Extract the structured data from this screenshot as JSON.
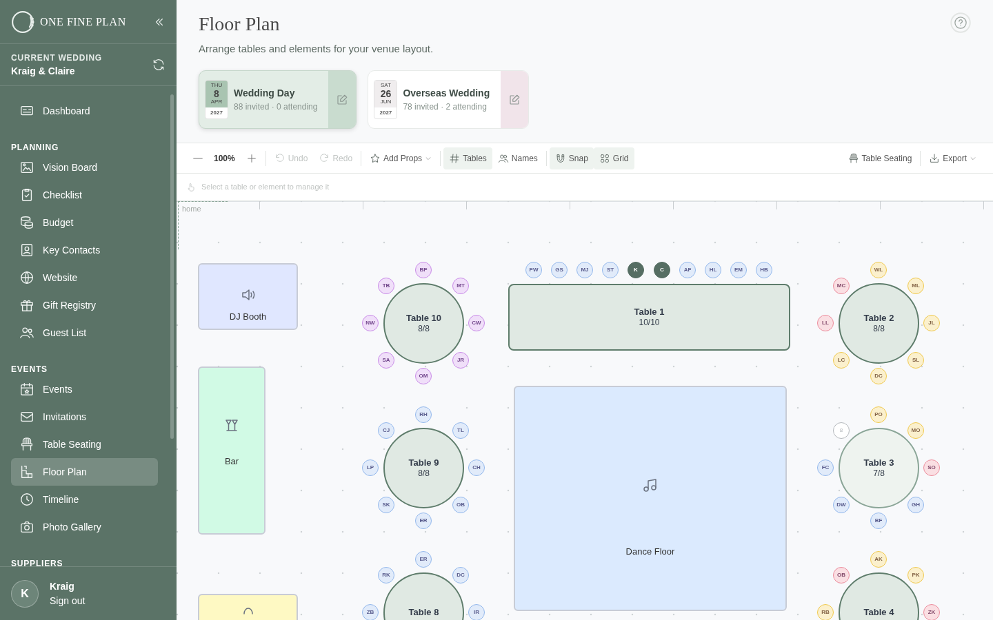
{
  "sidebar": {
    "brand": "ONE FINE PLAN",
    "current_wedding": {
      "label": "CURRENT WEDDING",
      "name": "Kraig & Claire"
    },
    "sections": [
      {
        "items": [
          {
            "label": "Dashboard",
            "selected": false
          }
        ]
      },
      {
        "heading": "PLANNING",
        "items": [
          {
            "label": "Vision Board",
            "selected": false
          },
          {
            "label": "Checklist",
            "selected": false
          },
          {
            "label": "Budget",
            "selected": false
          },
          {
            "label": "Key Contacts",
            "selected": false
          },
          {
            "label": "Website",
            "selected": false
          },
          {
            "label": "Gift Registry",
            "selected": false
          },
          {
            "label": "Guest List",
            "selected": false
          }
        ]
      },
      {
        "heading": "EVENTS",
        "items": [
          {
            "label": "Events",
            "selected": false
          },
          {
            "label": "Invitations",
            "selected": false
          },
          {
            "label": "Table Seating",
            "selected": false
          },
          {
            "label": "Floor Plan",
            "selected": true
          },
          {
            "label": "Timeline",
            "selected": false
          },
          {
            "label": "Photo Gallery",
            "selected": false
          }
        ]
      },
      {
        "heading": "SUPPLIERS"
      }
    ],
    "user": {
      "initial": "K",
      "name": "Kraig",
      "action": "Sign out"
    }
  },
  "header": {
    "title": "Floor Plan",
    "subtitle": "Arrange tables and elements for your venue layout."
  },
  "events": [
    {
      "weekday": "THU",
      "day": "8",
      "month": "APR",
      "year": "2027",
      "name": "Wedding Day",
      "stats": "88 invited · 0 attending",
      "selected": true,
      "color": "#c9dccf"
    },
    {
      "weekday": "SAT",
      "day": "26",
      "month": "JUN",
      "year": "2027",
      "name": "Overseas Wedding",
      "stats": "78 invited · 2 attending",
      "selected": false,
      "color": "#f1e4ea"
    }
  ],
  "toolbar": {
    "zoom": "100%",
    "buttons": [
      {
        "label": "Undo",
        "disabled": true,
        "on": false,
        "dropdown": false
      },
      {
        "label": "Redo",
        "disabled": true,
        "on": false,
        "dropdown": false
      },
      {
        "label": "Add Props",
        "disabled": false,
        "on": false,
        "dropdown": true
      },
      {
        "label": "Tables",
        "disabled": false,
        "on": true,
        "dropdown": false
      },
      {
        "label": "Names",
        "disabled": false,
        "on": false,
        "dropdown": false
      },
      {
        "label": "Snap",
        "disabled": false,
        "on": true,
        "dropdown": false
      },
      {
        "label": "Grid",
        "disabled": false,
        "on": true,
        "dropdown": false
      }
    ],
    "right_buttons": [
      {
        "label": "Table Seating",
        "dropdown": false
      },
      {
        "label": "Export",
        "dropdown": true
      }
    ]
  },
  "hint": "Select a table or element to manage it",
  "canvas": {
    "region_label": "home",
    "elements": [
      {
        "kind": "dj",
        "label": "DJ Booth",
        "color": "#e0e7ff"
      },
      {
        "kind": "bar",
        "label": "Bar",
        "color": "#d1fae5"
      },
      {
        "kind": "dance",
        "label": "Dance Floor",
        "color": "#dbeafe"
      },
      {
        "kind": "prop",
        "color": "#fef9c3"
      }
    ],
    "tables": [
      {
        "kind": "round",
        "name": "Table 10",
        "count": "8/8",
        "full": true,
        "seats": [
          {
            "initials": "BP",
            "kind": "guest",
            "color": "#c98be8"
          },
          {
            "initials": "MT",
            "kind": "guest",
            "color": "#c98be8"
          },
          {
            "initials": "CW",
            "kind": "guest",
            "color": "#c98be8"
          },
          {
            "initials": "JR",
            "kind": "guest",
            "color": "#c98be8"
          },
          {
            "initials": "OM",
            "kind": "guest",
            "color": "#c98be8"
          },
          {
            "initials": "SA",
            "kind": "guest",
            "color": "#c98be8"
          },
          {
            "initials": "NW",
            "kind": "guest",
            "color": "#c98be8"
          },
          {
            "initials": "TB",
            "kind": "guest",
            "color": "#c98be8"
          }
        ]
      },
      {
        "kind": "rect",
        "name": "Table 1",
        "count": "10/10",
        "full": true,
        "seats": [
          {
            "initials": "PW",
            "kind": "guest",
            "color": "#93b8ec"
          },
          {
            "initials": "GS",
            "kind": "guest",
            "color": "#93b8ec"
          },
          {
            "initials": "MJ",
            "kind": "guest",
            "color": "#93b8ec"
          },
          {
            "initials": "ST",
            "kind": "guest",
            "color": "#93b8ec"
          },
          {
            "initials": "K",
            "kind": "host",
            "color": "#566e63"
          },
          {
            "initials": "C",
            "kind": "host",
            "color": "#566e63"
          },
          {
            "initials": "AF",
            "kind": "guest",
            "color": "#93b8ec"
          },
          {
            "initials": "HL",
            "kind": "guest",
            "color": "#93b8ec"
          },
          {
            "initials": "EM",
            "kind": "guest",
            "color": "#93b8ec"
          },
          {
            "initials": "HB",
            "kind": "guest",
            "color": "#93b8ec"
          }
        ]
      },
      {
        "kind": "round",
        "name": "Table 2",
        "count": "8/8",
        "full": true,
        "seats": [
          {
            "initials": "WL",
            "kind": "guest",
            "color": "#f0c94e"
          },
          {
            "initials": "ML",
            "kind": "guest",
            "color": "#f0c94e"
          },
          {
            "initials": "JL",
            "kind": "guest",
            "color": "#f0c94e"
          },
          {
            "initials": "SL",
            "kind": "guest",
            "color": "#f0c94e"
          },
          {
            "initials": "DC",
            "kind": "guest",
            "color": "#f0c94e"
          },
          {
            "initials": "LC",
            "kind": "guest",
            "color": "#f0c94e"
          },
          {
            "initials": "LL",
            "kind": "guest",
            "color": "#ec8c9c"
          },
          {
            "initials": "MC",
            "kind": "guest",
            "color": "#ec8c9c"
          }
        ]
      },
      {
        "kind": "round",
        "name": "Table 9",
        "count": "8/8",
        "full": true,
        "seats": [
          {
            "initials": "RH",
            "kind": "guest",
            "color": "#93b8ec"
          },
          {
            "initials": "TL",
            "kind": "guest",
            "color": "#93b8ec"
          },
          {
            "initials": "CH",
            "kind": "guest",
            "color": "#93b8ec"
          },
          {
            "initials": "OB",
            "kind": "guest",
            "color": "#93b8ec"
          },
          {
            "initials": "ER",
            "kind": "guest",
            "color": "#93b8ec"
          },
          {
            "initials": "SK",
            "kind": "guest",
            "color": "#93b8ec"
          },
          {
            "initials": "LP",
            "kind": "guest",
            "color": "#93b8ec"
          },
          {
            "initials": "CJ",
            "kind": "guest",
            "color": "#93b8ec"
          }
        ]
      },
      {
        "kind": "round",
        "name": "Table 3",
        "count": "7/8",
        "full": false,
        "seats": [
          {
            "initials": "PO",
            "kind": "guest",
            "color": "#f0c94e"
          },
          {
            "initials": "MO",
            "kind": "guest",
            "color": "#f0c94e"
          },
          {
            "initials": "SO",
            "kind": "guest",
            "color": "#ec8c9c"
          },
          {
            "initials": "GH",
            "kind": "guest",
            "color": "#93b8ec"
          },
          {
            "initials": "BF",
            "kind": "guest",
            "color": "#93b8ec"
          },
          {
            "initials": "DW",
            "kind": "guest",
            "color": "#93b8ec"
          },
          {
            "initials": "FC",
            "kind": "guest",
            "color": "#93b8ec"
          },
          {
            "initials": "8",
            "kind": "empty",
            "color": "#b4b8bc"
          }
        ]
      },
      {
        "kind": "round",
        "name": "Table 8",
        "full": true,
        "seats": [
          {
            "initials": "ER",
            "kind": "guest",
            "color": "#93b8ec"
          },
          {
            "initials": "DC",
            "kind": "guest",
            "color": "#93b8ec"
          },
          {
            "initials": "IR",
            "kind": "guest",
            "color": "#93b8ec"
          },
          {
            "initials": "ZB",
            "kind": "guest",
            "color": "#93b8ec"
          },
          {
            "initials": "RK",
            "kind": "guest",
            "color": "#93b8ec"
          }
        ]
      },
      {
        "kind": "round",
        "name": "Table 4",
        "full": true,
        "seats": [
          {
            "initials": "AK",
            "kind": "guest",
            "color": "#f0c94e"
          },
          {
            "initials": "PK",
            "kind": "guest",
            "color": "#f0c94e"
          },
          {
            "initials": "ZK",
            "kind": "guest",
            "color": "#ec8c9c"
          },
          {
            "initials": "RB",
            "kind": "guest",
            "color": "#f0c94e"
          },
          {
            "initials": "OB",
            "kind": "guest",
            "color": "#ec8c9c"
          }
        ]
      }
    ]
  }
}
